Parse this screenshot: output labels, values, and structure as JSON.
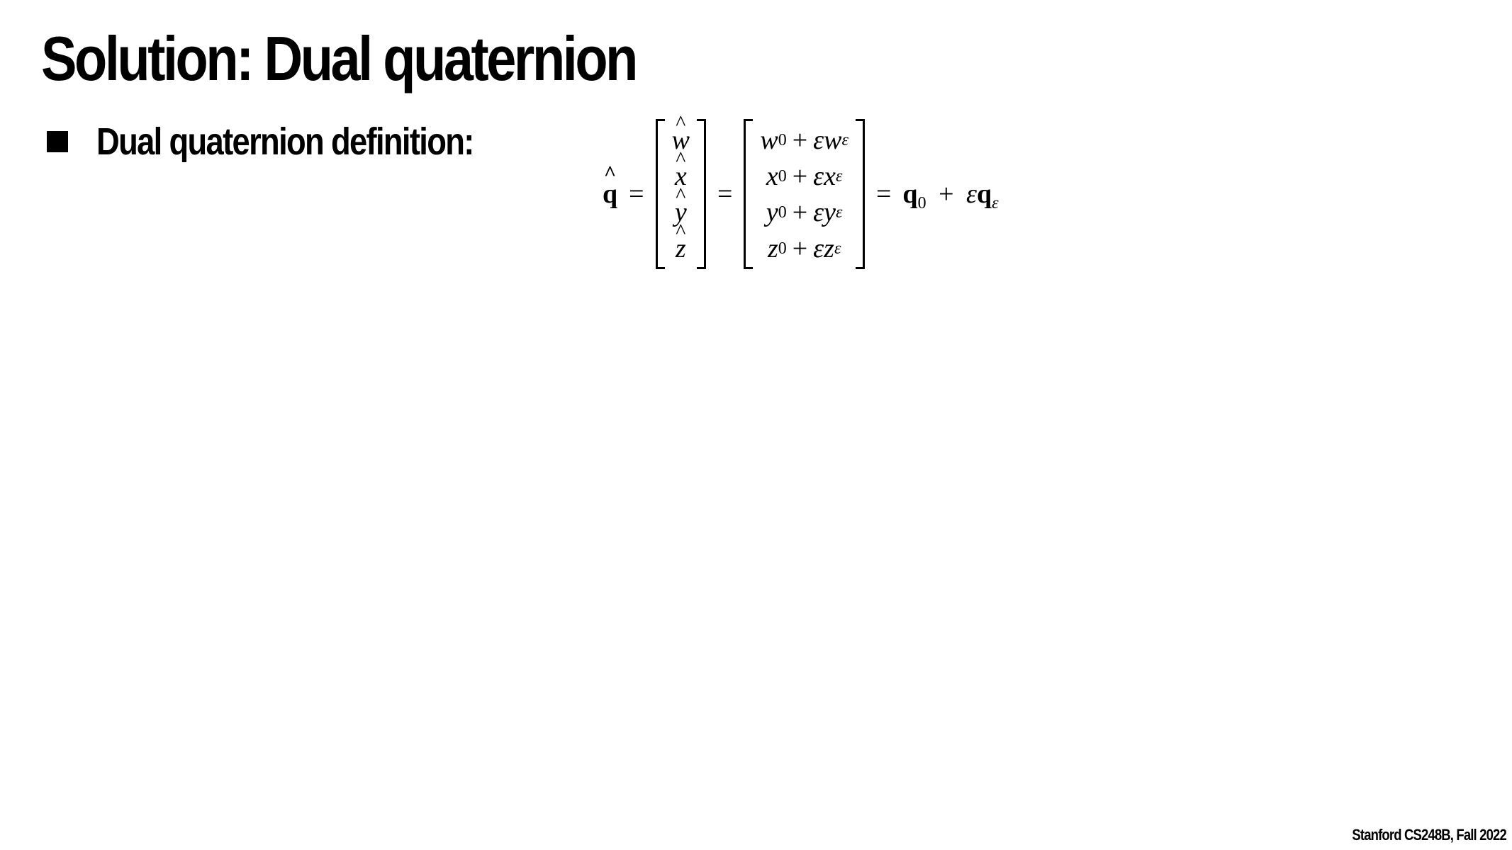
{
  "slide": {
    "title": "Solution: Dual quaternion",
    "bullet": "Dual quaternion definition:",
    "footer": "Stanford CS248B, Fall 2022"
  },
  "equation": {
    "lhs_symbol": "q",
    "equals": "=",
    "hat_vector": [
      "w",
      "x",
      "y",
      "z"
    ],
    "expanded_vector": [
      {
        "base": "w",
        "sub0": "0",
        "plus": "+",
        "eps": "ε",
        "dual": "w",
        "sub_eps": "ε"
      },
      {
        "base": "x",
        "sub0": "0",
        "plus": "+",
        "eps": "ε",
        "dual": "x",
        "sub_eps": "ε"
      },
      {
        "base": "y",
        "sub0": "0",
        "plus": "+",
        "eps": "ε",
        "dual": "y",
        "sub_eps": "ε"
      },
      {
        "base": "z",
        "sub0": "0",
        "plus": "+",
        "eps": "ε",
        "dual": "z",
        "sub_eps": "ε"
      }
    ],
    "rhs": {
      "q": "q",
      "sub0": "0",
      "plus": "+",
      "eps": "ε",
      "q_dual": "q",
      "sub_eps": "ε"
    }
  }
}
